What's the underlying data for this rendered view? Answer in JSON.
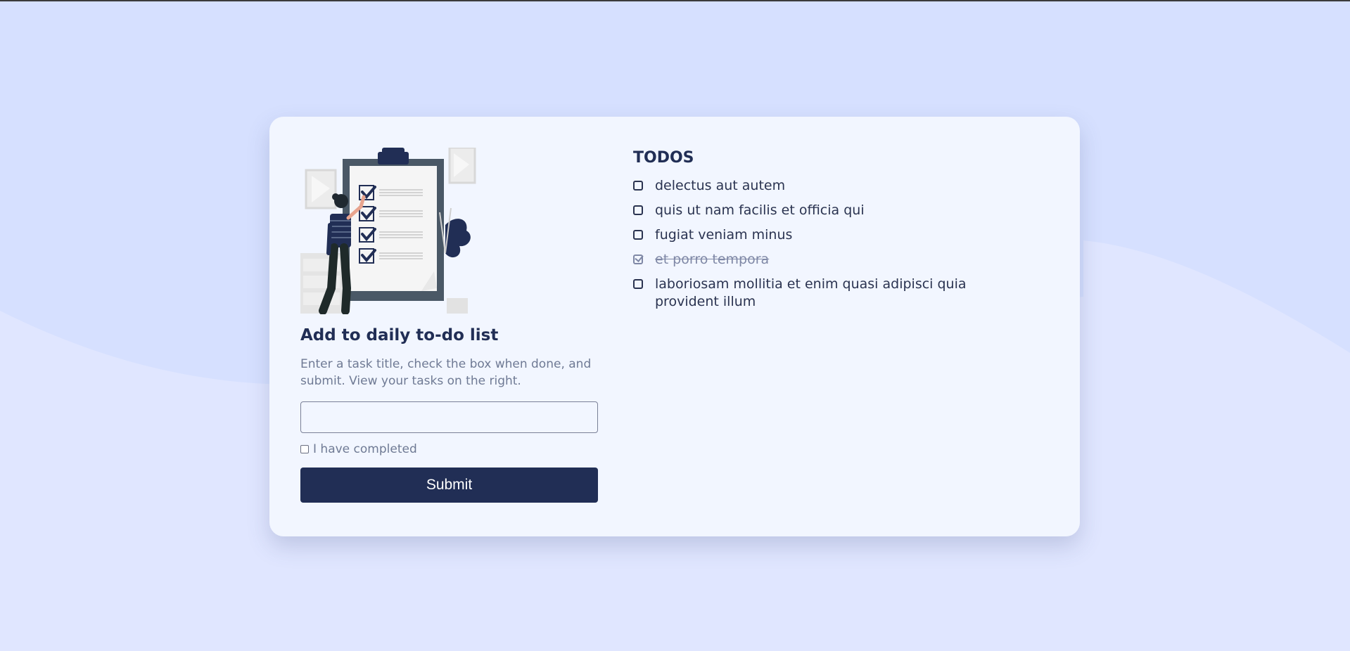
{
  "form": {
    "title": "Add to daily to-do list",
    "description": "Enter a task title, check the box when done, and submit. View your tasks on the right.",
    "input_value": "",
    "completed_label": "I have completed",
    "submit_label": "Submit"
  },
  "todos": {
    "title": "TODOS",
    "items": [
      {
        "text": "delectus aut autem",
        "completed": false
      },
      {
        "text": "quis ut nam facilis et officia qui",
        "completed": false
      },
      {
        "text": "fugiat veniam minus",
        "completed": false
      },
      {
        "text": "et porro tempora",
        "completed": true
      },
      {
        "text": "laboriosam mollitia et enim quasi adipisci quia provident illum",
        "completed": false
      }
    ]
  },
  "colors": {
    "page_background": "#d6e0ff",
    "card_background": "#f2f6ff",
    "primary": "#212e55",
    "muted_text": "#6f7a94"
  },
  "icons": {
    "illustration": "clipboard-checklist-illustration"
  }
}
